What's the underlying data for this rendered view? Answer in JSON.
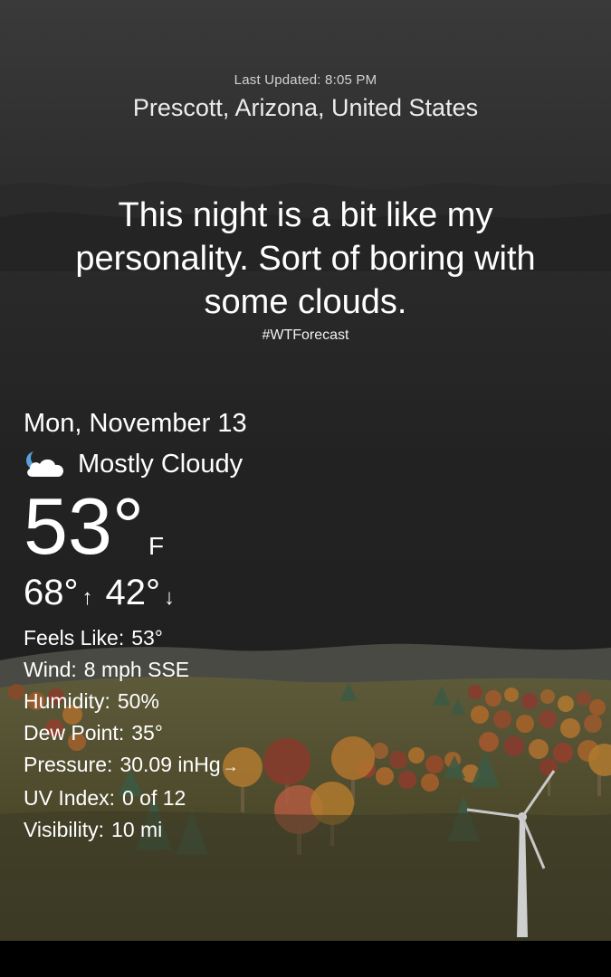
{
  "header": {
    "last_updated": "Last Updated: 8:05 PM",
    "location": "Prescott, Arizona, United States"
  },
  "forecast": {
    "quote": "This night is a bit like my personality. Sort of boring with some clouds.",
    "hashtag": "#WTForecast"
  },
  "current": {
    "date": "Mon, November 13",
    "condition_icon": "moon-cloud-icon",
    "condition": "Mostly Cloudy",
    "temperature": "53°",
    "unit": "F",
    "high": "68°",
    "low": "42°"
  },
  "details": [
    {
      "label": "Feels Like:",
      "value": "53°"
    },
    {
      "label": "Wind:",
      "value": "8 mph SSE"
    },
    {
      "label": "Humidity:",
      "value": "50%"
    },
    {
      "label": "Dew Point:",
      "value": "35°"
    },
    {
      "label": "Pressure:",
      "value": "30.09 inHg",
      "trend": "→"
    },
    {
      "label": "UV Index:",
      "value": "0 of 12"
    },
    {
      "label": "Visibility:",
      "value": "10 mi"
    }
  ],
  "arrows": {
    "up": "↑",
    "down": "↓"
  }
}
